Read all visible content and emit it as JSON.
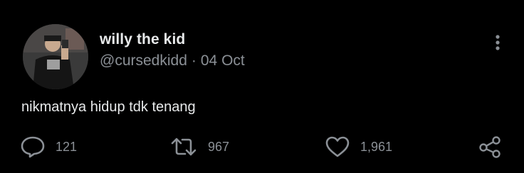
{
  "user": {
    "display_name": "willy the kid",
    "handle": "@cursedkidd",
    "separator": "·",
    "date": "04 Oct"
  },
  "tweet": {
    "text": "nikmatnya hidup tdk tenang"
  },
  "actions": {
    "reply": {
      "icon": "reply-icon",
      "count": "121"
    },
    "retweet": {
      "icon": "retweet-icon",
      "count": "967"
    },
    "like": {
      "icon": "heart-icon",
      "count": "1,961"
    },
    "share": {
      "icon": "share-icon"
    }
  },
  "colors": {
    "background": "#000000",
    "primary_text": "#e7e9ea",
    "secondary_text": "#8b9096"
  }
}
